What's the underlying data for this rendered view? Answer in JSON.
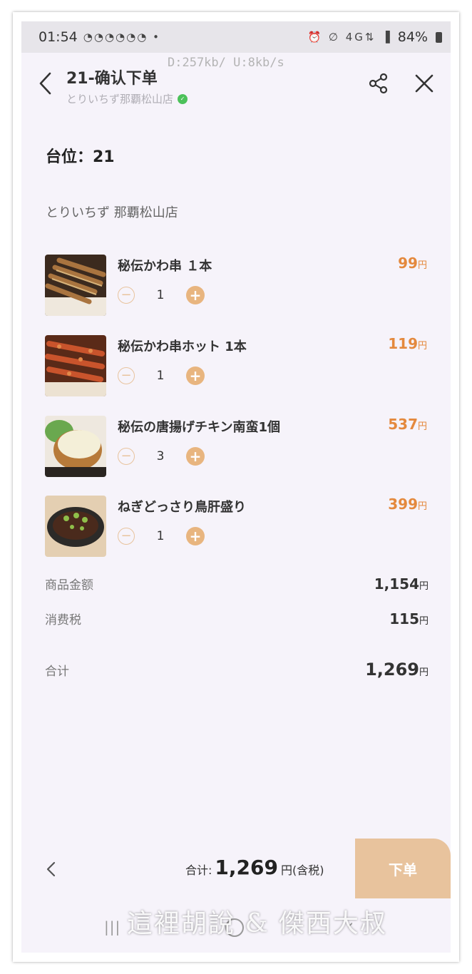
{
  "status_bar": {
    "time": "01:54",
    "notifications": "◔◔◔◔◔◔ •",
    "system_icons": "⏰ ∅ 4G⇅ ▐",
    "battery": "84%"
  },
  "header": {
    "title": "21-确认下单",
    "subtitle": "とりいちず那覇松山店",
    "network_speed": "D:257kb/  U:8kb/s"
  },
  "table": {
    "label": "台位：21"
  },
  "shop": {
    "name": "とりいちず 那覇松山店"
  },
  "items": [
    {
      "name": "秘伝かわ串 １本",
      "price": "99",
      "currency": "円",
      "qty": "1"
    },
    {
      "name": "秘伝かわ串ホット 1本",
      "price": "119",
      "currency": "円",
      "qty": "1"
    },
    {
      "name": "秘伝の唐揚げチキン南蛮1個",
      "price": "537",
      "currency": "円",
      "qty": "3"
    },
    {
      "name": "ねぎどっさり鳥肝盛り",
      "price": "399",
      "currency": "円",
      "qty": "1"
    }
  ],
  "summary": {
    "subtotal_label": "商品金额",
    "subtotal": "1,154",
    "tax_label": "消费税",
    "tax": "115",
    "total_label": "合计",
    "total": "1,269",
    "currency": "円"
  },
  "bottom_bar": {
    "total_prefix": "合计:",
    "total": "1,269",
    "suffix": "円(含税)",
    "order_button": "下单"
  },
  "watermark": "這裡胡說 & 傑西大叔",
  "colors": {
    "accent": "#e4893d",
    "button": "#e8c39d",
    "background": "#f6f3fa"
  },
  "icons": [
    "back-icon",
    "share-icon",
    "close-icon",
    "minus-icon",
    "plus-icon",
    "verified-icon"
  ]
}
